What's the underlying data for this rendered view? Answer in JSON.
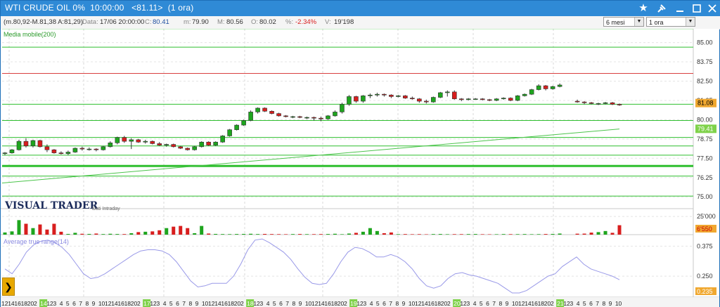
{
  "window": {
    "title": "WTI CRUDE OIL 0%  10:00:00   <81.11>  (1 ora)",
    "buttons": [
      "star-icon",
      "pin-icon",
      "minimize-icon",
      "maximize-icon",
      "close-icon"
    ]
  },
  "infobar": {
    "ohlc_label": "(m.80,92-M.81,38 A:81,29)",
    "data_label": "Data:",
    "data_value": "17/06 20:00:00",
    "c_label": "C:",
    "c_value": "80.41",
    "m_label": "m:",
    "m_value": "79.90",
    "M_label": "M:",
    "M_value": "80.56",
    "o_label": "O:",
    "o_value": "80.02",
    "pct_label": "%:",
    "pct_value": "-2.34%",
    "v_label": "V:",
    "v_value": "19'198"
  },
  "controls": {
    "period": "6 mesi",
    "timeframe": "1 ora"
  },
  "colors": {
    "up": "#1ea51e",
    "down": "#d81e1e",
    "ma": "#4cc44c",
    "atr": "#9999e8",
    "hline_green": "#2fbf2f",
    "hline_red": "#d94040",
    "last_price_box": "#f0a830",
    "ma_box": "#7fd24a"
  },
  "labels": {
    "ma_indicator": "Media mobile(200)",
    "brand": "VISUAL TRADER",
    "brand_sub": "Dati Intraday",
    "atr_indicator": "Average true range(14)",
    "last_price": "81.08",
    "ma_value": "79.41",
    "volume_value": "6'550",
    "atr_value": "0.235"
  },
  "chart_data": {
    "type": "candlestick",
    "price_axis": {
      "ticks": [
        "85.00",
        "83.75",
        "82.50",
        "81.25",
        "80.00",
        "78.75",
        "77.50",
        "76.25",
        "75.00"
      ],
      "min": 75.0,
      "max": 85.0
    },
    "horizontal_levels": [
      {
        "value": 85.9,
        "color": "green"
      },
      {
        "value": 84.7,
        "color": "green"
      },
      {
        "value": 83.0,
        "color": "red"
      },
      {
        "value": 81.0,
        "color": "green"
      },
      {
        "value": 79.95,
        "color": "green"
      },
      {
        "value": 78.85,
        "color": "green"
      },
      {
        "value": 78.3,
        "color": "green"
      },
      {
        "value": 77.7,
        "color": "green"
      },
      {
        "value": 77.0,
        "color": "green",
        "thick": true
      },
      {
        "value": 76.35,
        "color": "green"
      },
      {
        "value": 75.05,
        "color": "green"
      }
    ],
    "x_axis_labels": [
      "12",
      "14",
      "16",
      "18",
      "20",
      "2",
      "14",
      "12",
      "3",
      "4",
      "5",
      "6",
      "7",
      "8",
      "9",
      "10",
      "12",
      "14",
      "16",
      "18",
      "20",
      "2",
      "17",
      "12",
      "3",
      "4",
      "5",
      "6",
      "7",
      "8",
      "9",
      "10",
      "12",
      "14",
      "16",
      "18",
      "20",
      "2",
      "18",
      "12",
      "3",
      "4",
      "5",
      "6",
      "7",
      "8",
      "9",
      "10",
      "12",
      "14",
      "16",
      "18",
      "20",
      "2",
      "19",
      "12",
      "3",
      "4",
      "5",
      "6",
      "7",
      "8",
      "9",
      "10",
      "12",
      "14",
      "16",
      "18",
      "20",
      "2",
      "20",
      "12",
      "3",
      "4",
      "5",
      "6",
      "7",
      "8",
      "9",
      "10",
      "12",
      "14",
      "16",
      "18",
      "20",
      "2",
      "21",
      "12",
      "3",
      "4",
      "5",
      "6",
      "7",
      "8",
      "9",
      "10"
    ],
    "x_axis_highlight": [
      "14",
      "17",
      "18",
      "19",
      "20",
      "21"
    ],
    "candles": [
      [
        77.8,
        77.9,
        77.7,
        77.85
      ],
      [
        77.85,
        78.1,
        77.8,
        78.05
      ],
      [
        78.05,
        78.7,
        78.0,
        78.6
      ],
      [
        78.6,
        78.8,
        78.2,
        78.3
      ],
      [
        78.3,
        78.7,
        78.2,
        78.65
      ],
      [
        78.65,
        78.7,
        78.2,
        78.25
      ],
      [
        78.25,
        78.4,
        77.9,
        78.05
      ],
      [
        78.05,
        78.1,
        77.8,
        77.85
      ],
      [
        77.85,
        77.95,
        77.75,
        77.8
      ],
      [
        77.8,
        78.0,
        77.7,
        77.9
      ],
      [
        77.9,
        78.2,
        77.85,
        78.15
      ],
      [
        78.15,
        78.25,
        78.0,
        78.1
      ],
      [
        78.1,
        78.2,
        78.0,
        78.1
      ],
      [
        78.1,
        78.15,
        77.95,
        78.05
      ],
      [
        78.05,
        78.3,
        78.0,
        78.25
      ],
      [
        78.25,
        78.6,
        78.2,
        78.5
      ],
      [
        78.5,
        78.9,
        78.4,
        78.85
      ],
      [
        78.85,
        78.95,
        78.5,
        78.6
      ],
      [
        78.6,
        78.8,
        78.1,
        78.7
      ],
      [
        78.7,
        78.75,
        78.5,
        78.55
      ],
      [
        78.55,
        78.7,
        78.45,
        78.6
      ],
      [
        78.6,
        78.65,
        78.4,
        78.45
      ],
      [
        78.45,
        78.55,
        78.3,
        78.35
      ],
      [
        78.35,
        78.45,
        78.25,
        78.4
      ],
      [
        78.4,
        78.45,
        78.2,
        78.25
      ],
      [
        78.25,
        78.3,
        78.1,
        78.15
      ],
      [
        78.15,
        78.2,
        78.0,
        78.05
      ],
      [
        78.05,
        78.3,
        78.0,
        78.25
      ],
      [
        78.25,
        78.6,
        78.2,
        78.55
      ],
      [
        78.55,
        78.6,
        78.3,
        78.35
      ],
      [
        78.35,
        78.6,
        78.3,
        78.55
      ],
      [
        78.55,
        79.0,
        78.5,
        78.95
      ],
      [
        78.95,
        79.4,
        78.9,
        79.35
      ],
      [
        79.35,
        79.7,
        79.3,
        79.65
      ],
      [
        79.65,
        80.0,
        79.6,
        79.95
      ],
      [
        79.95,
        80.6,
        79.9,
        80.5
      ],
      [
        80.5,
        80.8,
        80.4,
        80.75
      ],
      [
        80.75,
        80.8,
        80.5,
        80.55
      ],
      [
        80.55,
        80.6,
        80.35,
        80.4
      ],
      [
        80.4,
        80.45,
        80.2,
        80.25
      ],
      [
        80.25,
        80.3,
        80.15,
        80.2
      ],
      [
        80.2,
        80.25,
        80.1,
        80.2
      ],
      [
        80.2,
        80.25,
        80.1,
        80.15
      ],
      [
        80.15,
        80.2,
        80.05,
        80.15
      ],
      [
        80.15,
        80.2,
        79.95,
        80.1
      ],
      [
        80.1,
        80.2,
        79.9,
        80.05
      ],
      [
        80.05,
        80.3,
        80.0,
        80.25
      ],
      [
        80.25,
        80.6,
        80.2,
        80.5
      ],
      [
        80.5,
        81.1,
        80.4,
        81.0
      ],
      [
        81.0,
        81.6,
        80.9,
        81.5
      ],
      [
        81.5,
        81.55,
        81.1,
        81.2
      ],
      [
        81.2,
        81.6,
        81.1,
        81.55
      ],
      [
        81.55,
        81.7,
        81.4,
        81.6
      ],
      [
        81.6,
        81.75,
        81.5,
        81.65
      ],
      [
        81.65,
        81.7,
        81.5,
        81.6
      ],
      [
        81.6,
        81.65,
        81.4,
        81.5
      ],
      [
        81.5,
        81.6,
        81.45,
        81.55
      ],
      [
        81.55,
        81.6,
        81.35,
        81.4
      ],
      [
        81.4,
        81.5,
        81.3,
        81.35
      ],
      [
        81.35,
        81.4,
        81.1,
        81.2
      ],
      [
        81.2,
        81.3,
        81.05,
        81.15
      ],
      [
        81.15,
        81.5,
        81.1,
        81.45
      ],
      [
        81.45,
        81.8,
        81.4,
        81.75
      ],
      [
        81.75,
        81.9,
        81.5,
        81.8
      ],
      [
        81.8,
        81.9,
        81.3,
        81.35
      ],
      [
        81.35,
        81.4,
        81.2,
        81.3
      ],
      [
        81.3,
        81.4,
        81.25,
        81.35
      ],
      [
        81.35,
        81.4,
        81.3,
        81.35
      ],
      [
        81.35,
        81.4,
        81.25,
        81.3
      ],
      [
        81.3,
        81.35,
        81.2,
        81.25
      ],
      [
        81.25,
        81.4,
        81.2,
        81.35
      ],
      [
        81.35,
        81.45,
        81.3,
        81.4
      ],
      [
        81.4,
        81.45,
        81.2,
        81.25
      ],
      [
        81.25,
        81.6,
        81.2,
        81.55
      ],
      [
        81.55,
        81.7,
        81.5,
        81.65
      ],
      [
        81.65,
        82.0,
        81.6,
        81.95
      ],
      [
        81.95,
        82.3,
        81.9,
        82.2
      ],
      [
        82.2,
        82.25,
        81.9,
        82.0
      ],
      [
        82.0,
        82.2,
        81.95,
        82.15
      ],
      [
        82.15,
        82.35,
        82.1,
        82.25
      ],
      [
        81.2,
        81.3,
        81.1,
        81.15
      ],
      [
        81.15,
        81.2,
        81.0,
        81.1
      ],
      [
        81.1,
        81.15,
        81.0,
        81.05
      ],
      [
        81.05,
        81.1,
        80.95,
        81.05
      ],
      [
        81.05,
        81.15,
        81.0,
        81.1
      ],
      [
        81.1,
        81.15,
        80.95,
        81.0
      ],
      [
        81.0,
        81.05,
        80.9,
        80.95
      ]
    ],
    "gaps_after": [
      79
    ],
    "moving_average_200": {
      "start": 75.9,
      "end": 79.4
    },
    "volume_axis": {
      "ticks": [
        "25'000"
      ],
      "max": 30000
    },
    "volume": [
      3000,
      4500,
      20000,
      15000,
      9000,
      14000,
      7000,
      15000,
      4000,
      1000,
      2500,
      1200,
      1000,
      1500,
      800,
      1200,
      900,
      800,
      2000,
      3500,
      4000,
      4500,
      6000,
      9000,
      11000,
      12000,
      9000,
      2000,
      12000,
      1500,
      1000,
      800,
      700,
      900,
      1000,
      1200,
      800,
      1000,
      800,
      700,
      600,
      800,
      900,
      700,
      700,
      800,
      900,
      1200,
      600,
      1500,
      2500,
      4000,
      9000,
      5000,
      2000,
      3000,
      700,
      800,
      600,
      700,
      500,
      800,
      900,
      600,
      700,
      700,
      800,
      900,
      600,
      500,
      600,
      800,
      700,
      700,
      800,
      600,
      700,
      900,
      1000,
      1500,
      1300,
      1400,
      2800,
      3500,
      5000,
      2500,
      13000
    ],
    "atr_axis": {
      "ticks": [
        "0.375",
        "0.250"
      ],
      "min": 0.18,
      "max": 0.42
    },
    "atr": [
      0.28,
      0.26,
      0.3,
      0.35,
      0.38,
      0.395,
      0.4,
      0.39,
      0.37,
      0.34,
      0.3,
      0.26,
      0.24,
      0.245,
      0.26,
      0.28,
      0.3,
      0.32,
      0.34,
      0.355,
      0.36,
      0.36,
      0.355,
      0.34,
      0.31,
      0.27,
      0.23,
      0.205,
      0.21,
      0.22,
      0.22,
      0.22,
      0.25,
      0.3,
      0.36,
      0.4,
      0.405,
      0.39,
      0.37,
      0.35,
      0.32,
      0.28,
      0.245,
      0.22,
      0.215,
      0.22,
      0.26,
      0.31,
      0.35,
      0.37,
      0.365,
      0.35,
      0.33,
      0.33,
      0.34,
      0.33,
      0.31,
      0.28,
      0.24,
      0.21,
      0.2,
      0.21,
      0.24,
      0.26,
      0.265,
      0.255,
      0.25,
      0.24,
      0.23,
      0.22,
      0.2,
      0.18,
      0.18,
      0.19,
      0.21,
      0.23,
      0.25,
      0.26,
      0.29,
      0.31,
      0.33,
      0.3,
      0.28,
      0.27,
      0.26,
      0.25,
      0.235
    ]
  }
}
